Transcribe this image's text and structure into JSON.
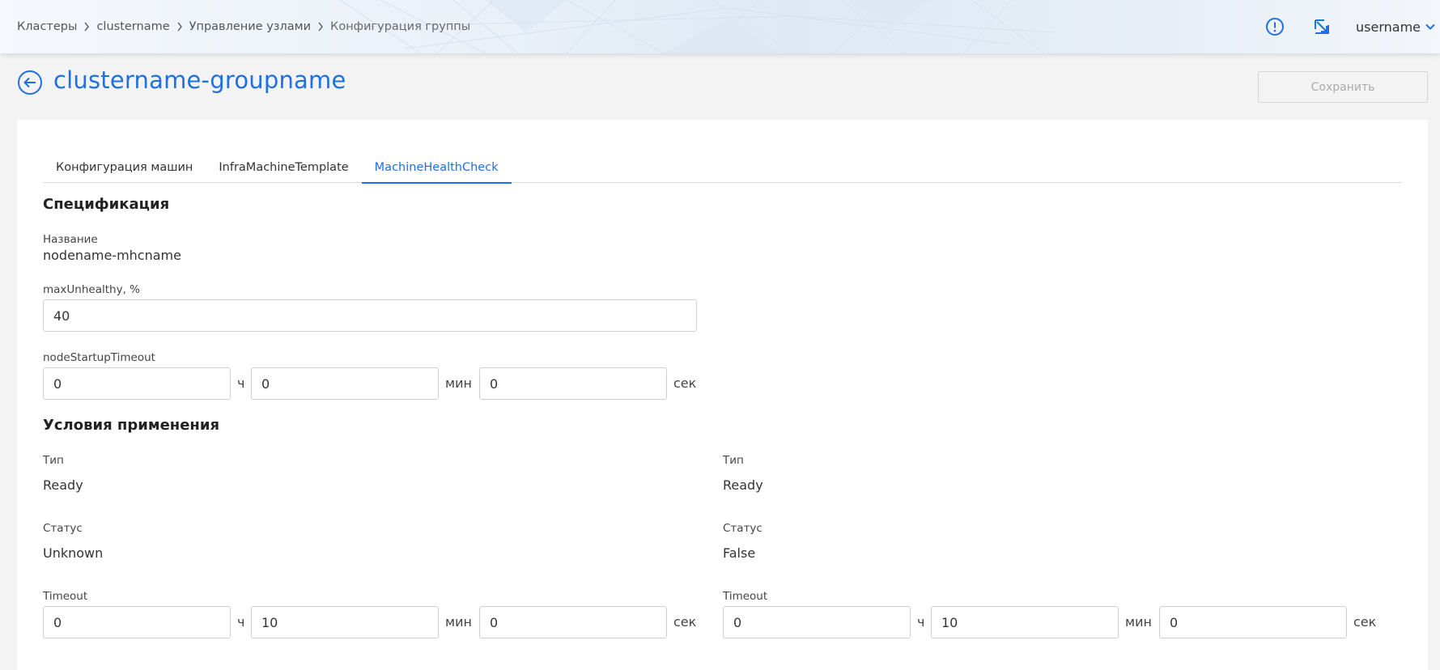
{
  "header": {
    "breadcrumbs": [
      "Кластеры",
      "clustername",
      "Управление узлами",
      "Конфигурация группы"
    ],
    "alert_icon": "alert-circle-icon",
    "external_icon": "open-external-icon",
    "username": "username"
  },
  "page": {
    "title": "clustername-groupname",
    "save_label": "Сохранить"
  },
  "tabs": [
    {
      "label": "Конфигурация машин",
      "active": false
    },
    {
      "label": "InfraMachineTemplate",
      "active": false
    },
    {
      "label": "MachineHealthCheck",
      "active": true
    }
  ],
  "spec": {
    "title": "Спецификация",
    "name_label": "Название",
    "name_value": "nodename-mhcname",
    "max_unhealthy_label": "maxUnhealthy, %",
    "max_unhealthy_value": "40",
    "startup_label": "nodeStartupTimeout",
    "startup": {
      "h": "0",
      "m": "0",
      "s": "0"
    }
  },
  "units": {
    "h": "ч",
    "m": "мин",
    "s": "сек"
  },
  "conditions": {
    "title": "Условия применения",
    "type_label": "Тип",
    "status_label": "Статус",
    "timeout_label": "Timeout",
    "items": [
      {
        "type": "Ready",
        "status": "Unknown",
        "timeout": {
          "h": "0",
          "m": "10",
          "s": "0"
        }
      },
      {
        "type": "Ready",
        "status": "False",
        "timeout": {
          "h": "0",
          "m": "10",
          "s": "0"
        }
      }
    ]
  },
  "colors": {
    "accent": "#1f6fe5",
    "background": "#f3f3f3",
    "card": "#ffffff"
  }
}
